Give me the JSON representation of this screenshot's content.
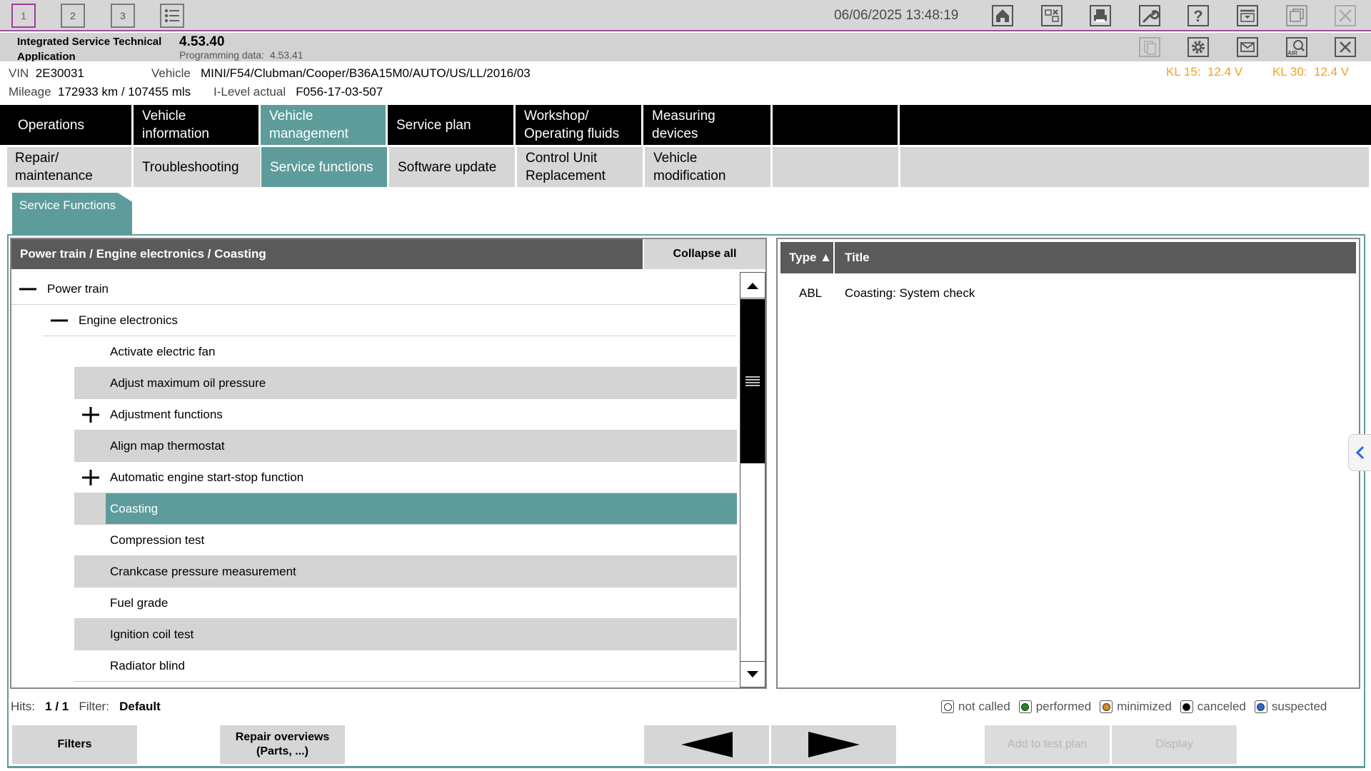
{
  "titlebar": {
    "windows": [
      "1",
      "2",
      "3"
    ],
    "datetime": "06/06/2025 13:48:19",
    "icons": [
      "home-icon",
      "cross-reference-icon",
      "print-icon",
      "wrench-icon",
      "help-icon",
      "dropdown-window-icon",
      "restore-window-icon",
      "close-window-icon"
    ]
  },
  "app": {
    "name": "Integrated Service Technical Application",
    "version": "4.53.40",
    "programming_label": "Programming data:",
    "programming_value": "4.53.41",
    "icons": [
      "clipboard-icon",
      "settings-icon",
      "mail-icon",
      "air-icon",
      "close-icon"
    ]
  },
  "vehicle": {
    "vin_label": "VIN",
    "vin": "2E30031",
    "vehicle_label": "Vehicle",
    "vehicle": "MINI/F54/Clubman/Cooper/B36A15M0/AUTO/US/LL/2016/03",
    "mileage_label": "Mileage",
    "mileage": "172933 km / 107455 mls",
    "ilevel_label": "I-Level actual",
    "ilevel": "F056-17-03-507",
    "kl15_label": "KL 15:",
    "kl15": "12.4 V",
    "kl30_label": "KL 30:",
    "kl30": "12.4 V",
    "voltage_color": "#f0a020"
  },
  "main_tabs": [
    "Operations",
    "Vehicle information",
    "Vehicle management",
    "Service plan",
    "Workshop/ Operating fluids",
    "Measuring devices",
    "",
    ""
  ],
  "sub_tabs": [
    "Repair/ maintenance",
    "Troubleshooting",
    "Service functions",
    "Software update",
    "Control Unit Replacement",
    "Vehicle modification",
    "",
    ""
  ],
  "badge": "Service Functions",
  "tree": {
    "breadcrumb": "Power train / Engine electronics / Coasting",
    "collapse_all": "Collapse all",
    "rows": [
      {
        "label": "Power train",
        "icon": "minus"
      },
      {
        "label": "Engine electronics",
        "icon": "minus"
      },
      {
        "label": "Activate electric fan",
        "icon": ""
      },
      {
        "label": "Adjust maximum oil pressure",
        "icon": ""
      },
      {
        "label": "Adjustment functions",
        "icon": "plus"
      },
      {
        "label": "Align map thermostat",
        "icon": ""
      },
      {
        "label": "Automatic engine start-stop function",
        "icon": "plus"
      },
      {
        "label": "Coasting",
        "icon": "",
        "selected": true
      },
      {
        "label": "Compression test",
        "icon": ""
      },
      {
        "label": "Crankcase pressure measurement",
        "icon": ""
      },
      {
        "label": "Fuel grade",
        "icon": ""
      },
      {
        "label": "Ignition coil test",
        "icon": ""
      },
      {
        "label": "Radiator blind",
        "icon": ""
      }
    ]
  },
  "results": {
    "col_type": "Type ▲",
    "col_title": "Title",
    "rows": [
      {
        "type": "ABL",
        "title": "Coasting: System check"
      }
    ]
  },
  "status": {
    "hits_label": "Hits:",
    "hits": "1 / 1",
    "filter_label": "Filter:",
    "filter": "Default"
  },
  "legend": [
    {
      "label": "not called",
      "color": "#ffffff"
    },
    {
      "label": "performed",
      "color": "#1a8a1a"
    },
    {
      "label": "minimized",
      "color": "#d98c1a"
    },
    {
      "label": "canceled",
      "color": "#000000"
    },
    {
      "label": "suspected",
      "color": "#2a6ad8"
    }
  ],
  "buttons": {
    "filters": "Filters",
    "repair_overviews": "Repair overviews (Parts, ...)",
    "add_to_test_plan": "Add to test plan",
    "display": "Display"
  },
  "colors": {
    "accent": "#5e9c9c",
    "header_grey": "#5a5a5a",
    "titlebar_border": "#9b4f9b"
  }
}
